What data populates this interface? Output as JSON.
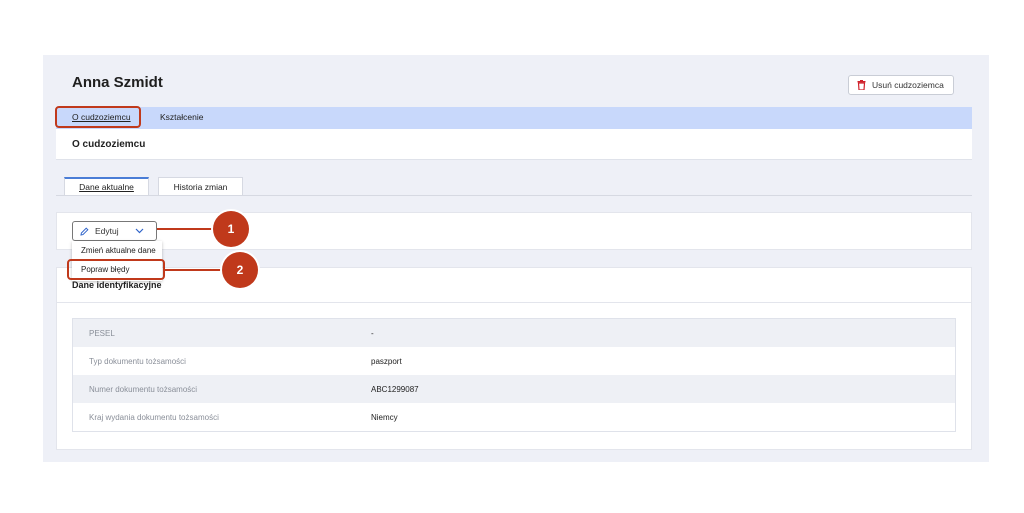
{
  "page": {
    "title": "Anna Szmidt",
    "delete_label": "Usuń cudzoziemca"
  },
  "tabs": [
    {
      "label": "O cudzoziemcu"
    },
    {
      "label": "Kształcenie"
    }
  ],
  "section": {
    "title": "O cudzoziemcu"
  },
  "subtabs": [
    {
      "label": "Dane aktualne"
    },
    {
      "label": "Historia zmian"
    }
  ],
  "edit": {
    "label": "Edytuj",
    "menu": [
      {
        "label": "Zmień aktualne dane"
      },
      {
        "label": "Popraw błędy"
      }
    ]
  },
  "callouts": [
    "1",
    "2"
  ],
  "identification": {
    "title": "Dane identyfikacyjne",
    "rows": [
      {
        "label": "PESEL",
        "value": "-"
      },
      {
        "label": "Typ dokumentu tożsamości",
        "value": "paszport"
      },
      {
        "label": "Numer dokumentu tożsamości",
        "value": "ABC1299087"
      },
      {
        "label": "Kraj wydania dokumentu tożsamości",
        "value": "Niemcy"
      }
    ]
  },
  "colors": {
    "accent": "#c0391b",
    "tabbar": "#c8d8fb",
    "panel": "#eef0f7"
  },
  "icons": {
    "delete": "trash-icon",
    "edit": "pencil-icon",
    "dropdown": "chevron-down-icon"
  }
}
